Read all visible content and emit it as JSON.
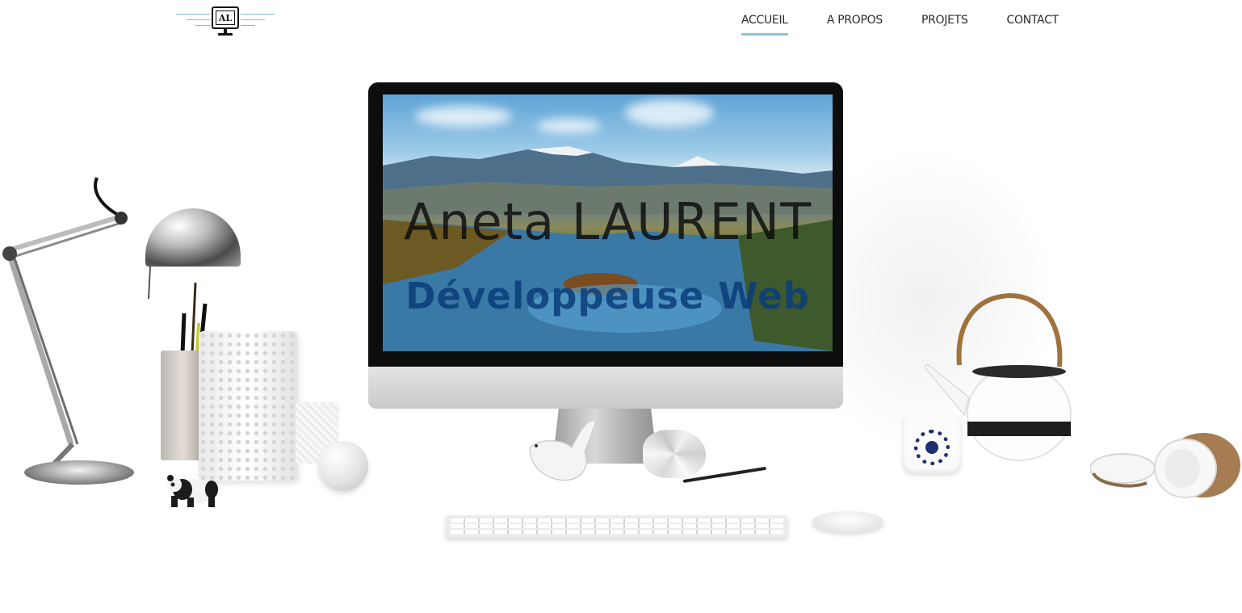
{
  "logo": {
    "text": "AL"
  },
  "nav": {
    "items": [
      {
        "label": "ACCUEIL",
        "active": true
      },
      {
        "label": "A PROPOS",
        "active": false
      },
      {
        "label": "PROJETS",
        "active": false
      },
      {
        "label": "CONTACT",
        "active": false
      }
    ],
    "active_color": "#8cc6d6"
  },
  "hero": {
    "name": "Aneta LAURENT",
    "role": "Développeuse Web"
  },
  "colors": {
    "accent": "#8cc6d6",
    "text": "#2b2b2b",
    "background": "#ffffff"
  }
}
